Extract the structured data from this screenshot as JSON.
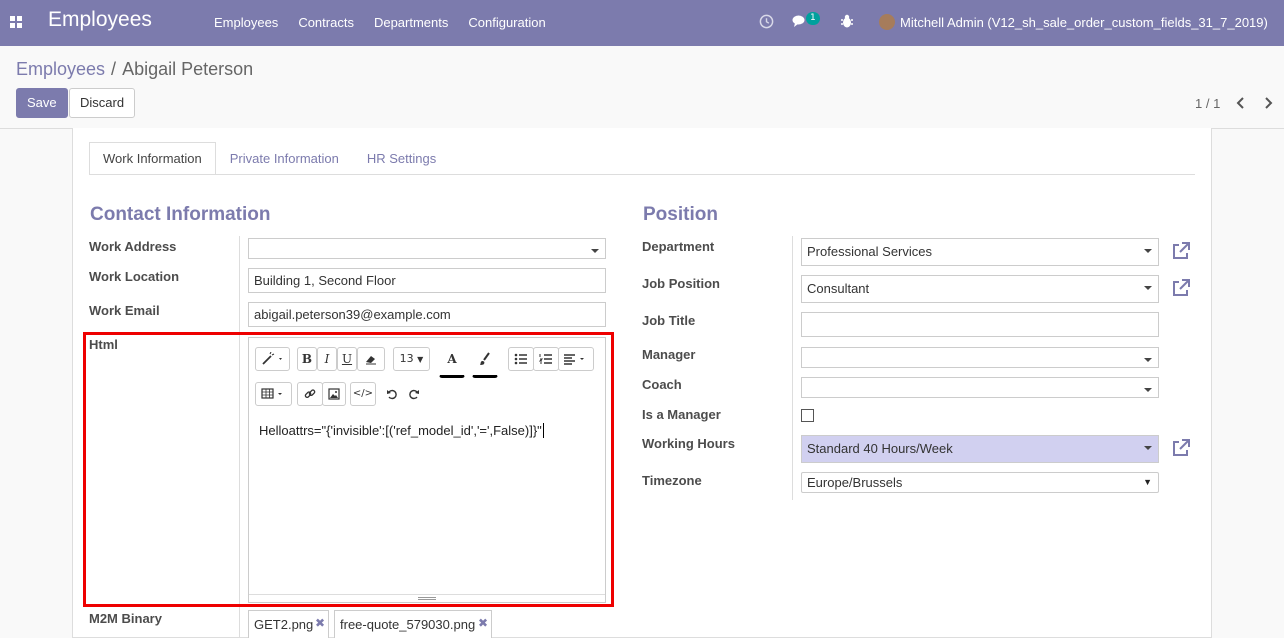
{
  "nav": {
    "brand": "Employees",
    "menu": [
      "Employees",
      "Contracts",
      "Departments",
      "Configuration"
    ],
    "chat_count": "1",
    "user": "Mitchell Admin (V12_sh_sale_order_custom_fields_31_7_2019)"
  },
  "breadcrumb": {
    "parent": "Employees",
    "separator": "/",
    "current": "Abigail Peterson"
  },
  "buttons": {
    "save": "Save",
    "discard": "Discard"
  },
  "pager": {
    "text": "1 / 1"
  },
  "tabs": [
    "Work Information",
    "Private Information",
    "HR Settings"
  ],
  "contact": {
    "title": "Contact Information",
    "work_address_label": "Work Address",
    "work_address_value": "",
    "work_location_label": "Work Location",
    "work_location_value": "Building 1, Second Floor",
    "work_email_label": "Work Email",
    "work_email_value": "abigail.peterson39@example.com",
    "html_label": "Html",
    "html_content": "Helloattrs=\"{'invisible':[('ref_model_id','=',False)]}\"",
    "font_size": "13",
    "m2m_label": "M2M Binary",
    "attachments": [
      "GET2.png",
      "free-quote_579030.png"
    ]
  },
  "position": {
    "title": "Position",
    "department_label": "Department",
    "department_value": "Professional Services",
    "job_position_label": "Job Position",
    "job_position_value": "Consultant",
    "job_title_label": "Job Title",
    "job_title_value": "",
    "manager_label": "Manager",
    "manager_value": "",
    "coach_label": "Coach",
    "coach_value": "",
    "is_manager_label": "Is a Manager",
    "is_manager_value": false,
    "working_hours_label": "Working Hours",
    "working_hours_value": "Standard 40 Hours/Week",
    "timezone_label": "Timezone",
    "timezone_value": "Europe/Brussels"
  },
  "colors": {
    "brand": "#7c7bad",
    "highlight": "#d1d0f0",
    "red_box": "#ee0000"
  }
}
